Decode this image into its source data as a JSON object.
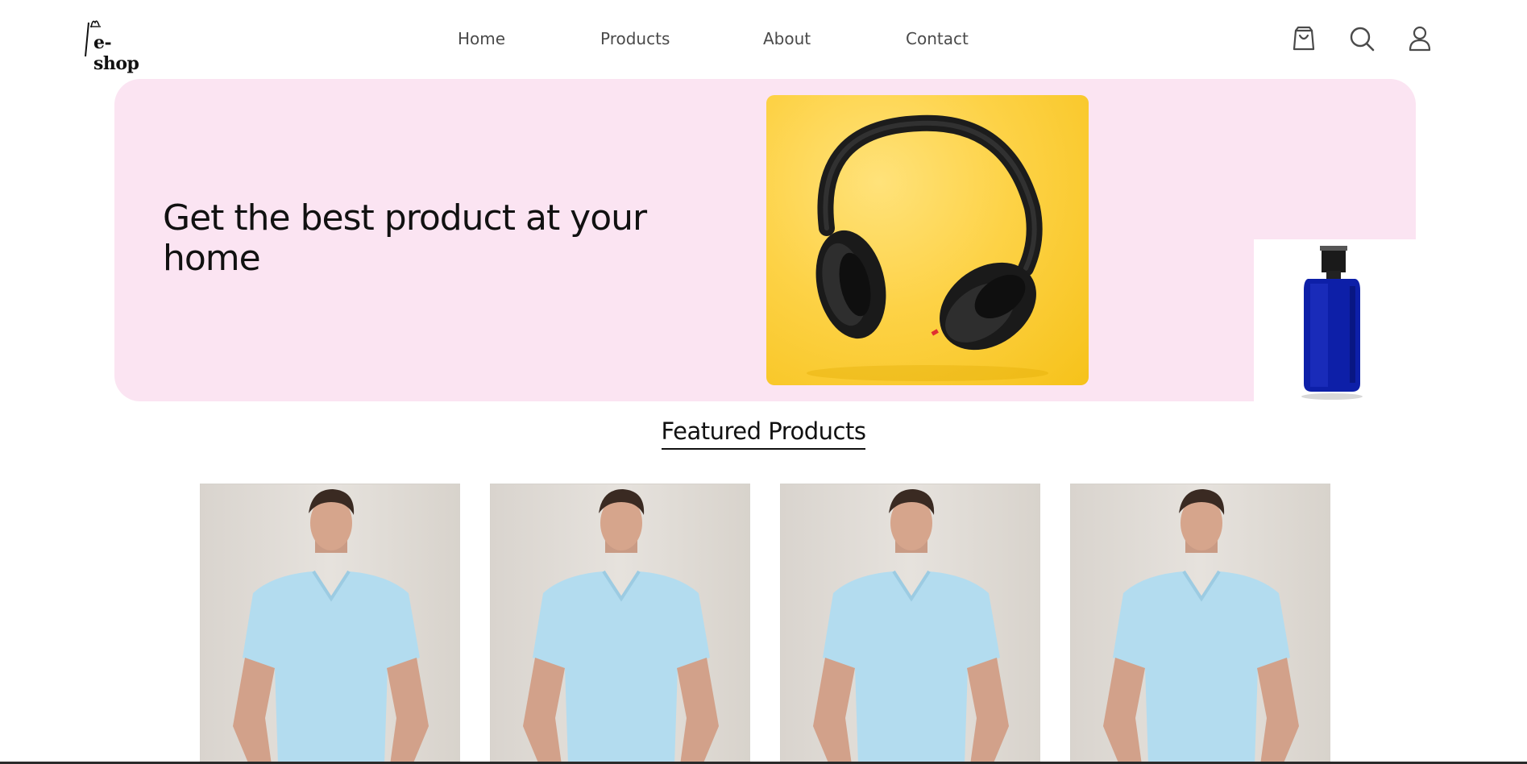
{
  "brand": {
    "logo_text": "e-shop"
  },
  "nav": {
    "items": [
      {
        "label": "Home"
      },
      {
        "label": "Products"
      },
      {
        "label": "About"
      },
      {
        "label": "Contact"
      }
    ]
  },
  "header_icons": [
    "shopping-bag-icon",
    "search-icon",
    "user-icon"
  ],
  "hero": {
    "title": "Get the best product at your home",
    "background_color": "#fbe4f2",
    "images": [
      "headphones",
      "perfume-bottle"
    ]
  },
  "featured": {
    "title": "Featured Products",
    "products": [
      {
        "image": "man-in-light-blue-v-neck-tshirt"
      },
      {
        "image": "man-in-light-blue-v-neck-tshirt"
      },
      {
        "image": "man-in-light-blue-v-neck-tshirt"
      },
      {
        "image": "man-in-light-blue-v-neck-tshirt"
      }
    ]
  }
}
